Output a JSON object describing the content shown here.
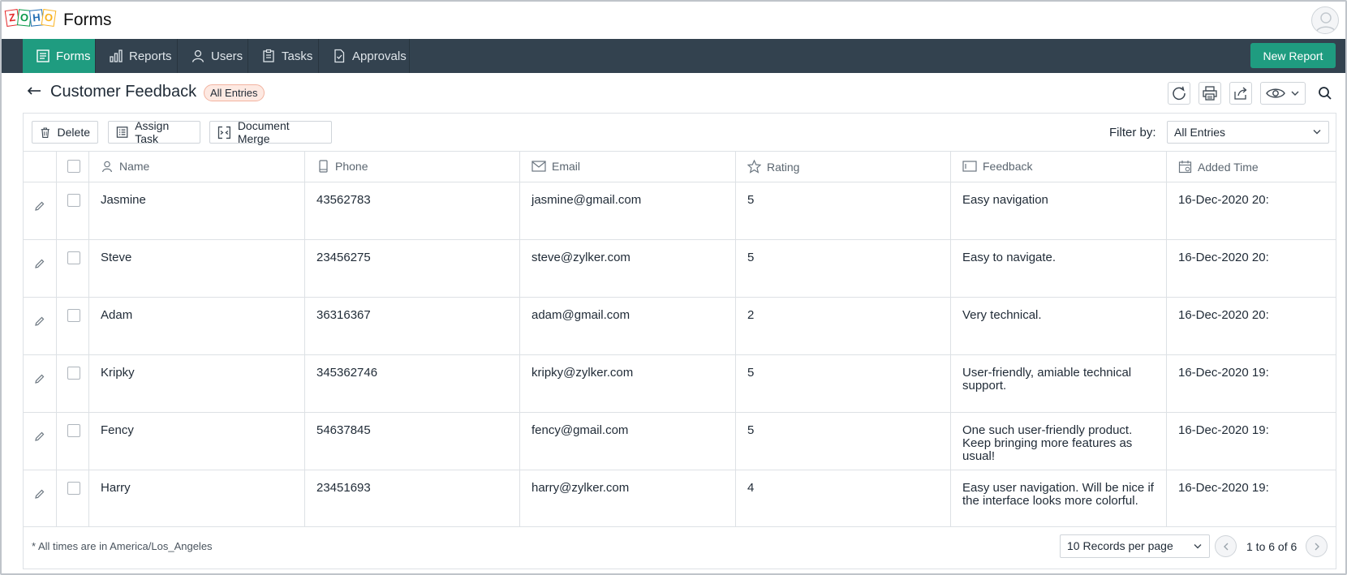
{
  "app": {
    "title": "Forms"
  },
  "nav": {
    "items": [
      {
        "label": "Forms",
        "icon": "form-icon",
        "active": true
      },
      {
        "label": "Reports",
        "icon": "bar-chart-icon"
      },
      {
        "label": "Users",
        "icon": "user-icon"
      },
      {
        "label": "Tasks",
        "icon": "clipboard-icon"
      },
      {
        "label": "Approvals",
        "icon": "document-check-icon"
      }
    ],
    "new_report_label": "New Report"
  },
  "page": {
    "title": "Customer Feedback",
    "badge": "All Entries"
  },
  "actions": {
    "delete_label": "Delete",
    "assign_task_label": "Assign Task",
    "document_merge_label": "Document Merge",
    "filter_label": "Filter by:",
    "filter_value": "All Entries"
  },
  "table": {
    "columns": [
      "Name",
      "Phone",
      "Email",
      "Rating",
      "Feedback",
      "Added Time"
    ],
    "rows": [
      {
        "name": "Jasmine",
        "phone": "43562783",
        "email": "jasmine@gmail.com",
        "rating": "5",
        "feedback": "Easy navigation",
        "added": "16-Dec-2020 20:"
      },
      {
        "name": "Steve",
        "phone": "23456275",
        "email": "steve@zylker.com",
        "rating": "5",
        "feedback": "Easy to navigate.",
        "added": "16-Dec-2020 20:"
      },
      {
        "name": "Adam",
        "phone": "36316367",
        "email": "adam@gmail.com",
        "rating": "2",
        "feedback": "Very technical.",
        "added": "16-Dec-2020 20:"
      },
      {
        "name": "Kripky",
        "phone": "345362746",
        "email": "kripky@zylker.com",
        "rating": "5",
        "feedback": "User-friendly, amiable technical support.",
        "added": "16-Dec-2020 19:"
      },
      {
        "name": "Fency",
        "phone": "54637845",
        "email": "fency@gmail.com",
        "rating": "5",
        "feedback": "One such user-friendly product. Keep bringing more features as usual!",
        "added": "16-Dec-2020 19:"
      },
      {
        "name": "Harry",
        "phone": "23451693",
        "email": "harry@zylker.com",
        "rating": "4",
        "feedback": "Easy user navigation. Will be nice if the interface looks more colorful.",
        "added": "16-Dec-2020 19:"
      }
    ]
  },
  "footer": {
    "note": "* All times are in America/Los_Angeles",
    "per_page": "10 Records per page",
    "range": "1 to 6 of 6"
  },
  "colors": {
    "nav_bg": "#33424f",
    "accent": "#1f9c80",
    "badge_bg": "#fde9e2"
  }
}
